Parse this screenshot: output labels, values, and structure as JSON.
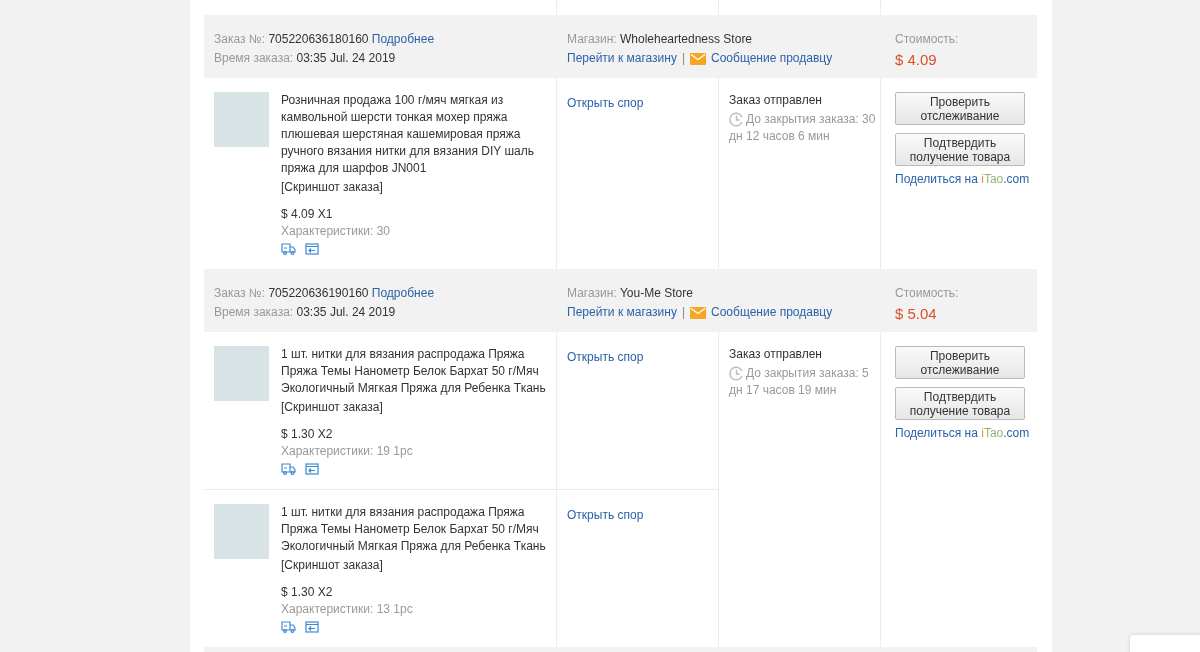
{
  "orders": [
    {
      "order_label": "Заказ №:",
      "number": "705220636180160",
      "details_link": "Подробнее",
      "time_label": "Время заказа:",
      "time": "03:35 Jul. 24 2019",
      "store_label": "Магазин:",
      "store": "Wholeheartedness Store",
      "store_link": "Перейти к магазину",
      "separator": "|",
      "message_link": "Сообщение продавцу",
      "cost_label": "Стоимость:",
      "cost": "$ 4.09",
      "status": "Заказ отправлен",
      "countdown": "До закрытия заказа: 30 дн 12 часов 6 мин",
      "buttons": [
        "Проверить отслеживание",
        "Подтвердить получение товара"
      ],
      "share_text": "Поделиться на",
      "share_brand": [
        "i",
        "Tao"
      ],
      "share_domain": ".com",
      "items": [
        {
          "title": "Розничная продажа 100 г/мяч мягкая из камвольной шерсти тонкая мохер пряжа плюшевая шерстяная кашемировая пряжа ручного вязания нитки для вязания DIY шаль пряжа для шарфов JN001",
          "snapshot": "[Скриншот заказа]",
          "price": "$ 4.09 X1",
          "specs": "Характеристики: 30",
          "dispute": "Открыть спор"
        }
      ]
    },
    {
      "order_label": "Заказ №:",
      "number": "705220636190160",
      "details_link": "Подробнее",
      "time_label": "Время заказа:",
      "time": "03:35 Jul. 24 2019",
      "store_label": "Магазин:",
      "store": "You-Me Store",
      "store_link": "Перейти к магазину",
      "separator": "|",
      "message_link": "Сообщение продавцу",
      "cost_label": "Стоимость:",
      "cost": "$ 5.04",
      "status": "Заказ отправлен",
      "countdown": "До закрытия заказа: 5 дн 17 часов 19 мин",
      "buttons": [
        "Проверить отслеживание",
        "Подтвердить получение товара"
      ],
      "share_text": "Поделиться на",
      "share_brand": [
        "i",
        "Tao"
      ],
      "share_domain": ".com",
      "items": [
        {
          "title": "1 шт. нитки для вязания распродажа Пряжа Пряжа Темы Нанометр Белок Бархат 50 г/Мяч Экологичный Мягкая Пряжа для Ребенка Ткань",
          "snapshot": "[Скриншот заказа]",
          "price": "$ 1.30 X2",
          "specs": "Характеристики: 19 1pc",
          "dispute": "Открыть спор"
        },
        {
          "title": "1 шт. нитки для вязания распродажа Пряжа Пряжа Темы Нанометр Белок Бархат 50 г/Мяч Экологичный Мягкая Пряжа для Ребенка Ткань",
          "snapshot": "[Скриншот заказа]",
          "price": "$ 1.30 X2",
          "specs": "Характеристики: 13 1pc",
          "dispute": "Открыть спор"
        }
      ]
    }
  ]
}
